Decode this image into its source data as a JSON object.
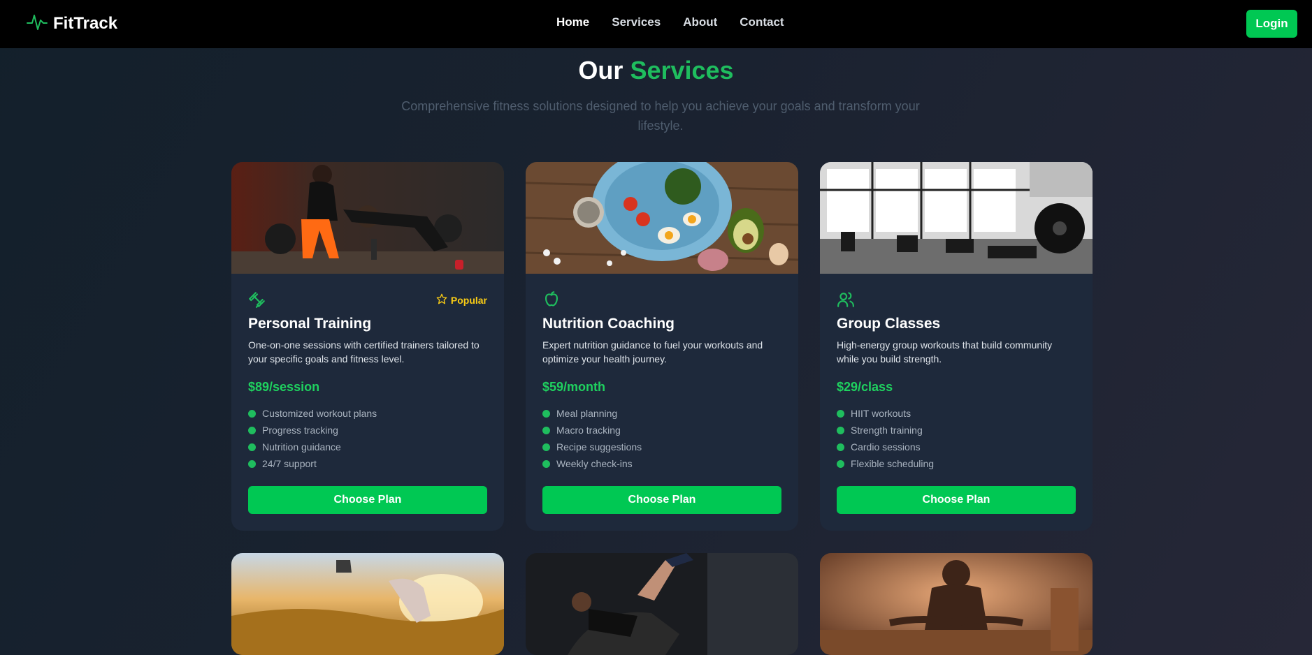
{
  "nav": {
    "brand": "FitTrack",
    "links": [
      "Home",
      "Services",
      "About",
      "Contact"
    ],
    "login": "Login"
  },
  "header": {
    "title_part1": "Our",
    "title_part2": "Services",
    "subtitle": "Comprehensive fitness solutions designed to help you achieve your goals and transform your lifestyle."
  },
  "colors": {
    "accent": "#00c853",
    "popular": "#facc15",
    "card_bg": "#1e293b"
  },
  "cards": [
    {
      "icon": "dumbbell-icon",
      "badge": "Popular",
      "title": "Personal Training",
      "description": "One-on-one sessions with certified trainers tailored to your specific goals and fitness level.",
      "price": "$89/session",
      "features": [
        "Customized workout plans",
        "Progress tracking",
        "Nutrition guidance",
        "24/7 support"
      ],
      "button": "Choose Plan"
    },
    {
      "icon": "apple-icon",
      "badge": "",
      "title": "Nutrition Coaching",
      "description": "Expert nutrition guidance to fuel your workouts and optimize your health journey.",
      "price": "$59/month",
      "features": [
        "Meal planning",
        "Macro tracking",
        "Recipe suggestions",
        "Weekly check-ins"
      ],
      "button": "Choose Plan"
    },
    {
      "icon": "users-icon",
      "badge": "",
      "title": "Group Classes",
      "description": "High-energy group workouts that build community while you build strength.",
      "price": "$29/class",
      "features": [
        "HIIT workouts",
        "Strength training",
        "Cardio sessions",
        "Flexible scheduling"
      ],
      "button": "Choose Plan"
    }
  ]
}
